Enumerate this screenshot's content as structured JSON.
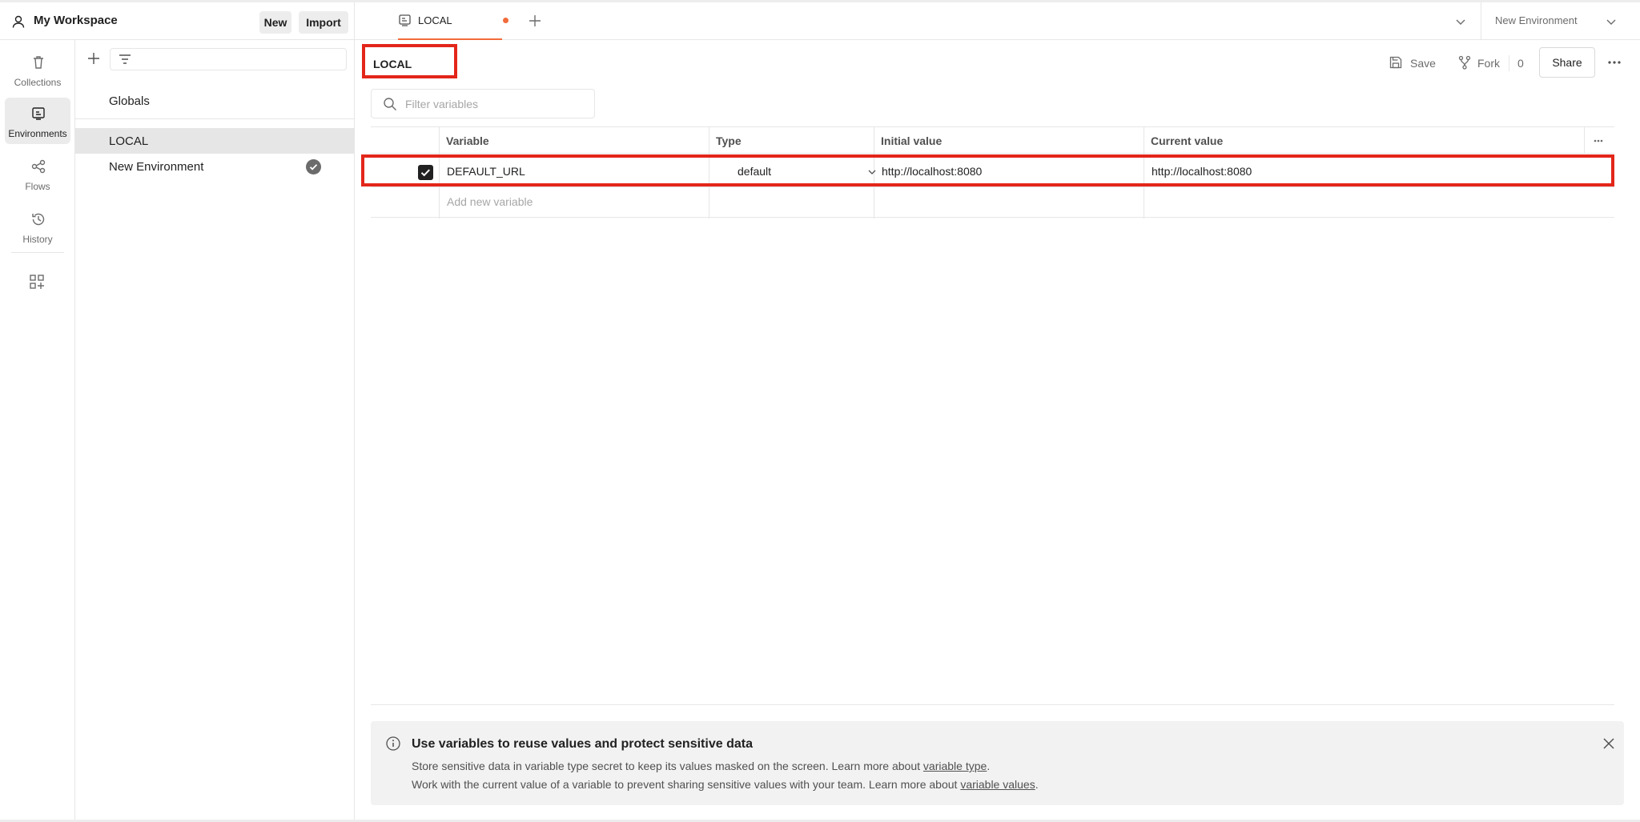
{
  "workspace": {
    "title": "My Workspace",
    "new_label": "New",
    "import_label": "Import"
  },
  "rail": {
    "items": [
      {
        "label": "Collections",
        "icon": "trash-collection-icon"
      },
      {
        "label": "Environments",
        "icon": "environment-icon",
        "active": true
      },
      {
        "label": "Flows",
        "icon": "flows-icon"
      },
      {
        "label": "History",
        "icon": "history-icon"
      }
    ]
  },
  "sidebar": {
    "globals_label": "Globals",
    "items": [
      {
        "label": "LOCAL",
        "active": true
      },
      {
        "label": "New Environment",
        "active_environment": true
      }
    ]
  },
  "tabs": [
    {
      "label": "LOCAL",
      "unsaved": true
    }
  ],
  "env_selector": {
    "value": "New Environment"
  },
  "main": {
    "env_name": "LOCAL",
    "save_label": "Save",
    "fork_label": "Fork",
    "fork_count": "0",
    "share_label": "Share",
    "filter_placeholder": "Filter variables"
  },
  "table": {
    "columns": [
      "Variable",
      "Type",
      "Initial value",
      "Current value"
    ],
    "rows": [
      {
        "checked": true,
        "variable": "DEFAULT_URL",
        "type": "default",
        "initial": "http://localhost:8080",
        "current": "http://localhost:8080"
      }
    ],
    "add_placeholder": "Add new variable"
  },
  "info": {
    "title": "Use variables to reuse values and protect sensitive data",
    "line1_prefix": "Store sensitive data in variable type secret to keep its values masked on the screen. Learn more about ",
    "line1_link": "variable type",
    "line1_suffix": ".",
    "line2_prefix": "Work with the current value of a variable to prevent sharing sensitive values with your team. Learn more about ",
    "line2_link": "variable values",
    "line2_suffix": "."
  },
  "colors": {
    "accent": "#f26b3a",
    "highlight": "#e3261a"
  }
}
